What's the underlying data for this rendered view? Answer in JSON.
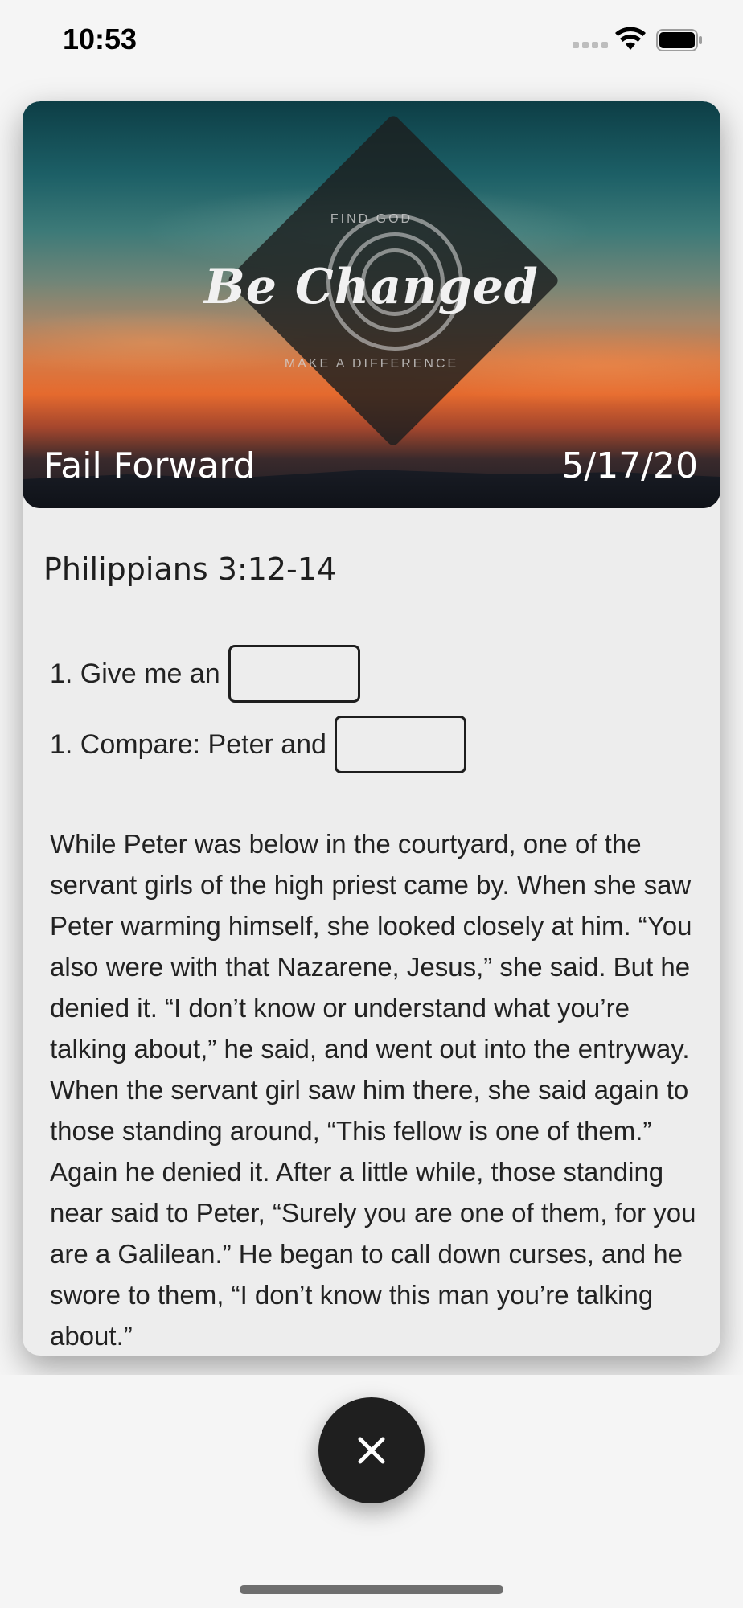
{
  "status_bar": {
    "time": "10:53"
  },
  "sermon": {
    "logo_top_text": "FIND GOD",
    "logo_main_text": "Be Changed",
    "logo_bottom_text": "MAKE A DIFFERENCE",
    "title": "Fail Forward",
    "date": "5/17/20",
    "scripture_reference": "Philippians 3:12-14"
  },
  "fill_in_blanks": [
    {
      "label": "1. Give me an"
    },
    {
      "label": "1. Compare: Peter and"
    }
  ],
  "passage": {
    "text": "While Peter was below in the courtyard, one of the servant girls of the high priest came by. When she saw Peter warming himself, she looked closely at him. “You also were with that Nazarene, Jesus,” she said. But he denied it. “I don’t know or understand what you’re talking about,” he said, and went out into the entryway. When the servant girl saw him there, she said again to those standing around, “This fellow is one of them.” Again he denied it. After a little while, those standing near said to Peter, “Surely you are one of them, for you are a Galilean.” He began to call down curses, and he swore to them, “I don’t know this man you’re talking about.”"
  },
  "icons": {
    "wifi": "wifi-icon",
    "battery": "battery-icon",
    "close": "close-icon"
  },
  "colors": {
    "close_button_bg": "#1f1f1f",
    "page_bg": "#f5f5f5",
    "card_bg": "#ededed"
  }
}
